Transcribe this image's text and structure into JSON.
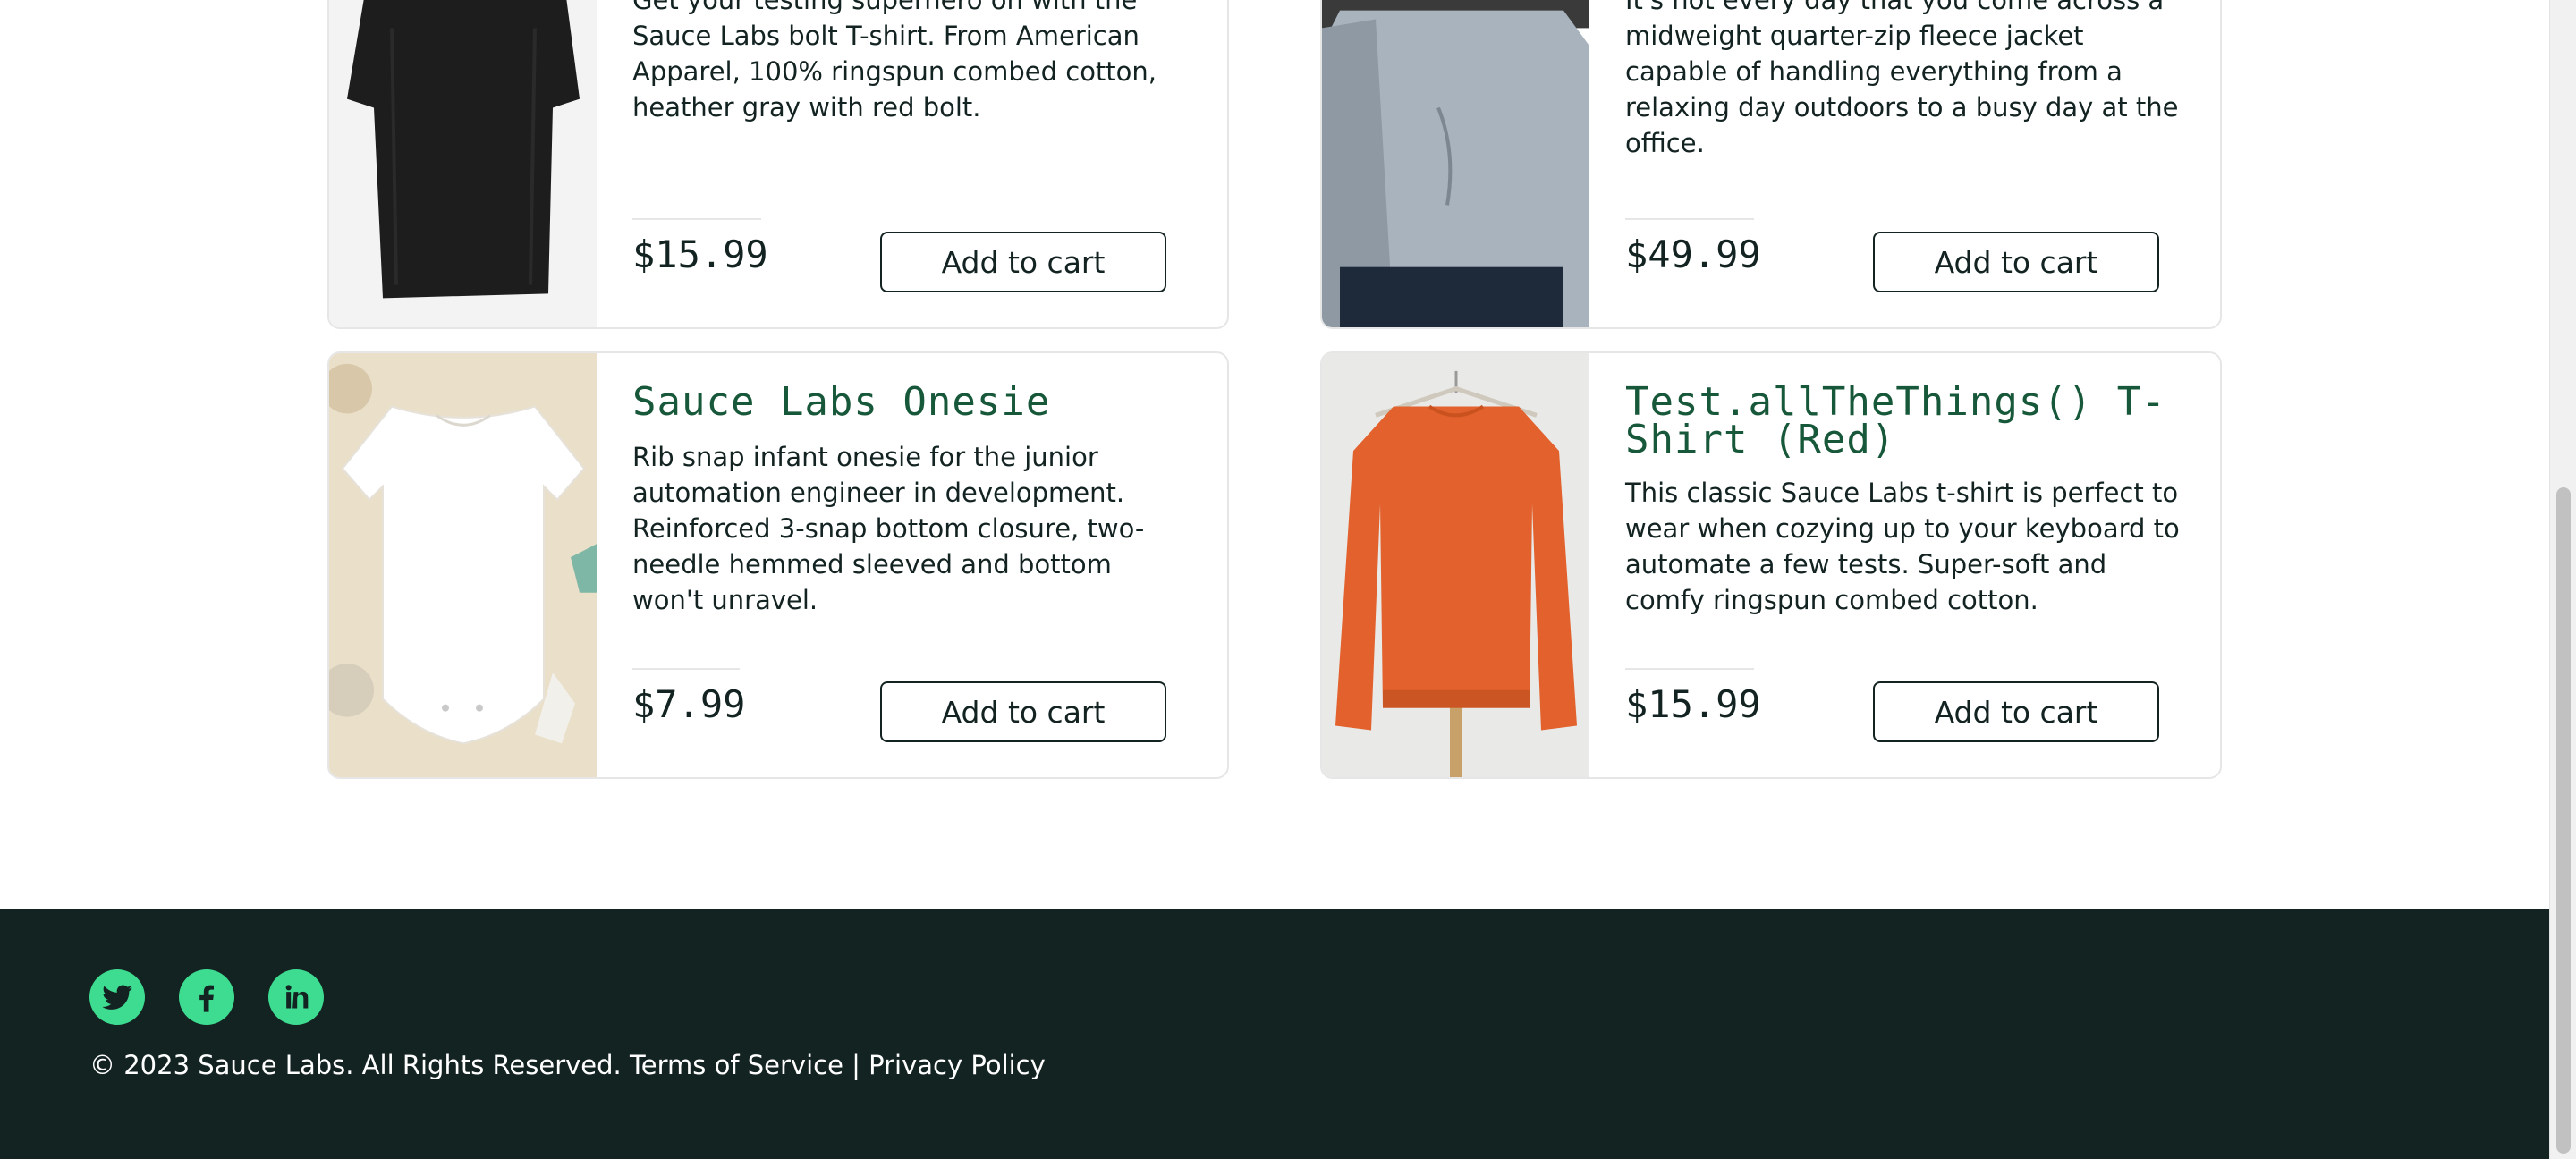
{
  "products": [
    {
      "name": "",
      "description": "Get your testing superhero on with the Sauce Labs bolt T-shirt. From American Apparel, 100% ringspun combed cotton, heather gray with red bolt.",
      "price": "$15.99",
      "button": "Add to cart",
      "image": "black-tshirt-image"
    },
    {
      "name": "",
      "description": "It's not every day that you come across a midweight quarter-zip fleece jacket capable of handling everything from a relaxing day outdoors to a busy day at the office.",
      "price": "$49.99",
      "button": "Add to cart",
      "image": "gray-fleece-jacket-image"
    },
    {
      "name": "Sauce Labs Onesie",
      "description": "Rib snap infant onesie for the junior automation engineer in development. Reinforced 3-snap bottom closure, two-needle hemmed sleeved and bottom won't unravel.",
      "price": "$7.99",
      "button": "Add to cart",
      "image": "white-onesie-image"
    },
    {
      "name": "Test.allTheThings() T-Shirt (Red)",
      "description": "This classic Sauce Labs t-shirt is perfect to wear when cozying up to your keyboard to automate a few tests. Super-soft and comfy ringspun combed cotton.",
      "price": "$15.99",
      "button": "Add to cart",
      "image": "red-sweatshirt-image"
    }
  ],
  "footer": {
    "social": [
      "twitter-icon",
      "facebook-icon",
      "linkedin-icon"
    ],
    "copyright": "© 2023 Sauce Labs. All Rights Reserved.",
    "terms": "Terms of Service",
    "separator": "|",
    "privacy": "Privacy Policy"
  },
  "colors": {
    "title": "#18583a",
    "footer_bg": "#132322",
    "social_bg": "#3ddc91",
    "border": "#e6e6e6"
  }
}
